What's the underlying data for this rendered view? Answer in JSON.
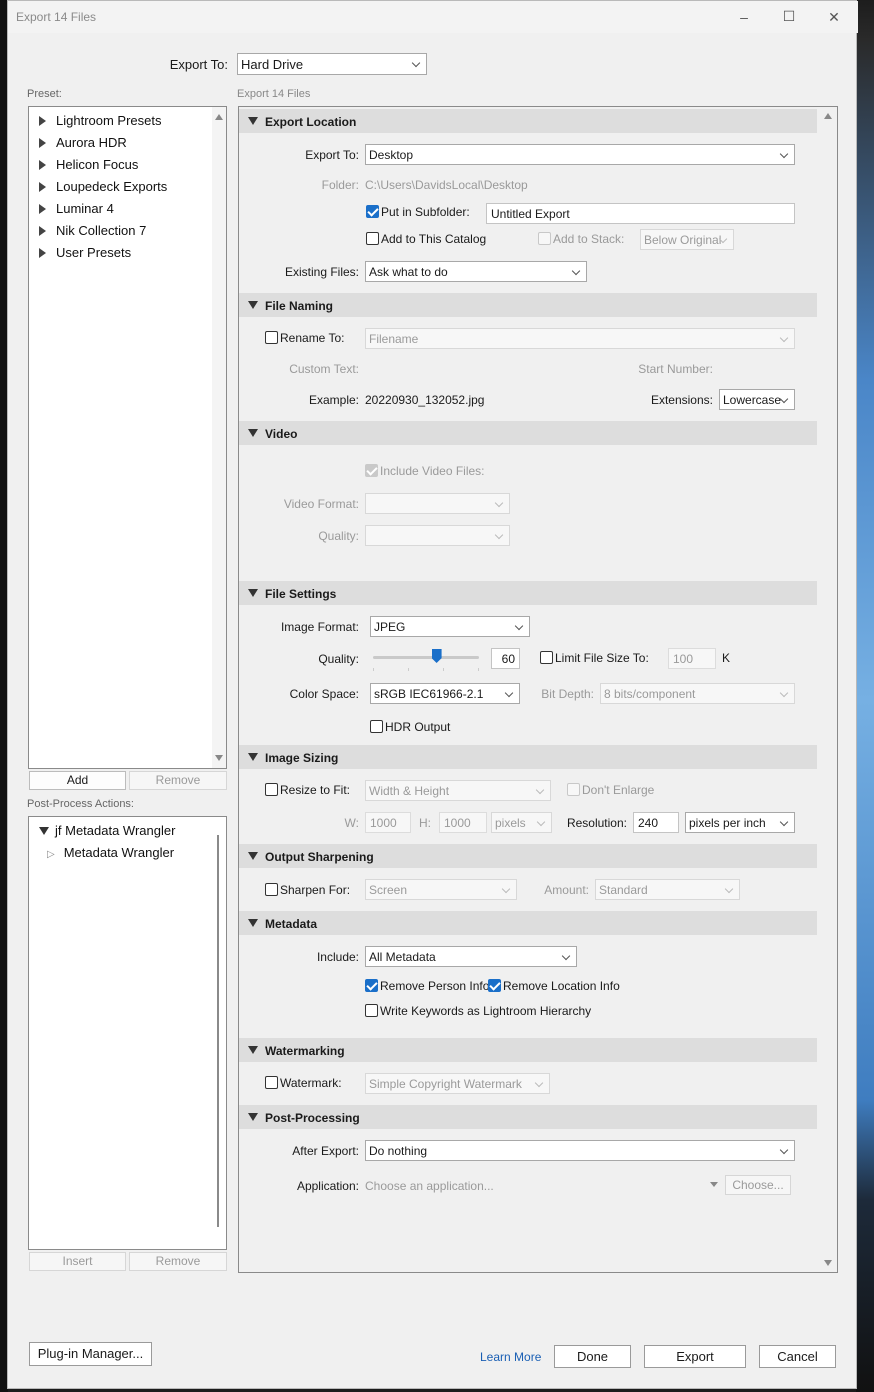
{
  "window": {
    "title": "Export 14 Files"
  },
  "export_to": {
    "label": "Export To:",
    "value": "Hard Drive"
  },
  "preset": {
    "label": "Preset:",
    "items": [
      "Lightroom Presets",
      "Aurora HDR",
      "Helicon Focus",
      "Loupedeck Exports",
      "Luminar 4",
      "Nik Collection 7",
      "User Presets"
    ],
    "add": "Add",
    "remove": "Remove"
  },
  "post_process_actions": {
    "label": "Post-Process Actions:",
    "group": "jf Metadata Wrangler",
    "child": "Metadata Wrangler",
    "insert": "Insert",
    "remove": "Remove"
  },
  "right_header": "Export 14 Files",
  "export_location": {
    "title": "Export Location",
    "export_to_label": "Export To:",
    "export_to_value": "Desktop",
    "folder_label": "Folder:",
    "folder_value": "C:\\Users\\DavidsLocal\\Desktop",
    "subfolder_label": "Put in Subfolder:",
    "subfolder_value": "Untitled Export",
    "subfolder_checked": true,
    "add_catalog_label": "Add to This Catalog",
    "add_stack_label": "Add to Stack:",
    "stack_value": "Below Original",
    "existing_label": "Existing Files:",
    "existing_value": "Ask what to do"
  },
  "file_naming": {
    "title": "File Naming",
    "rename_label": "Rename To:",
    "rename_value": "Filename",
    "custom_text_label": "Custom Text:",
    "start_number_label": "Start Number:",
    "example_label": "Example:",
    "example_value": "20220930_132052.jpg",
    "extensions_label": "Extensions:",
    "extensions_value": "Lowercase"
  },
  "video": {
    "title": "Video",
    "include_label": "Include Video Files:",
    "format_label": "Video Format:",
    "quality_label": "Quality:"
  },
  "file_settings": {
    "title": "File Settings",
    "format_label": "Image Format:",
    "format_value": "JPEG",
    "quality_label": "Quality:",
    "quality_value": "60",
    "quality_fraction": 0.6,
    "limit_label": "Limit File Size To:",
    "limit_value": "100",
    "limit_unit": "K",
    "color_label": "Color Space:",
    "color_value": "sRGB IEC61966-2.1",
    "bitdepth_label": "Bit Depth:",
    "bitdepth_value": "8 bits/component",
    "hdr_label": "HDR Output"
  },
  "image_sizing": {
    "title": "Image Sizing",
    "resize_label": "Resize to Fit:",
    "resize_value": "Width & Height",
    "dont_enlarge_label": "Don't Enlarge",
    "w_label": "W:",
    "w_value": "1000",
    "h_label": "H:",
    "h_value": "1000",
    "unit_value": "pixels",
    "res_label": "Resolution:",
    "res_value": "240",
    "res_unit": "pixels per inch"
  },
  "output_sharpening": {
    "title": "Output Sharpening",
    "sharpen_label": "Sharpen For:",
    "sharpen_value": "Screen",
    "amount_label": "Amount:",
    "amount_value": "Standard"
  },
  "metadata": {
    "title": "Metadata",
    "include_label": "Include:",
    "include_value": "All Metadata",
    "remove_person_label": "Remove Person Info",
    "remove_location_label": "Remove Location Info",
    "keywords_label": "Write Keywords as Lightroom Hierarchy"
  },
  "watermarking": {
    "title": "Watermarking",
    "watermark_label": "Watermark:",
    "watermark_value": "Simple Copyright Watermark"
  },
  "post_processing": {
    "title": "Post-Processing",
    "after_label": "After Export:",
    "after_value": "Do nothing",
    "app_label": "Application:",
    "app_placeholder": "Choose an application...",
    "choose": "Choose..."
  },
  "footer": {
    "plugin_manager": "Plug-in Manager...",
    "learn_more": "Learn More",
    "done": "Done",
    "export": "Export",
    "cancel": "Cancel"
  },
  "colors": {
    "accent": "#1a6fc9",
    "link": "#1a5fb4",
    "section_bg": "#dddddd"
  }
}
